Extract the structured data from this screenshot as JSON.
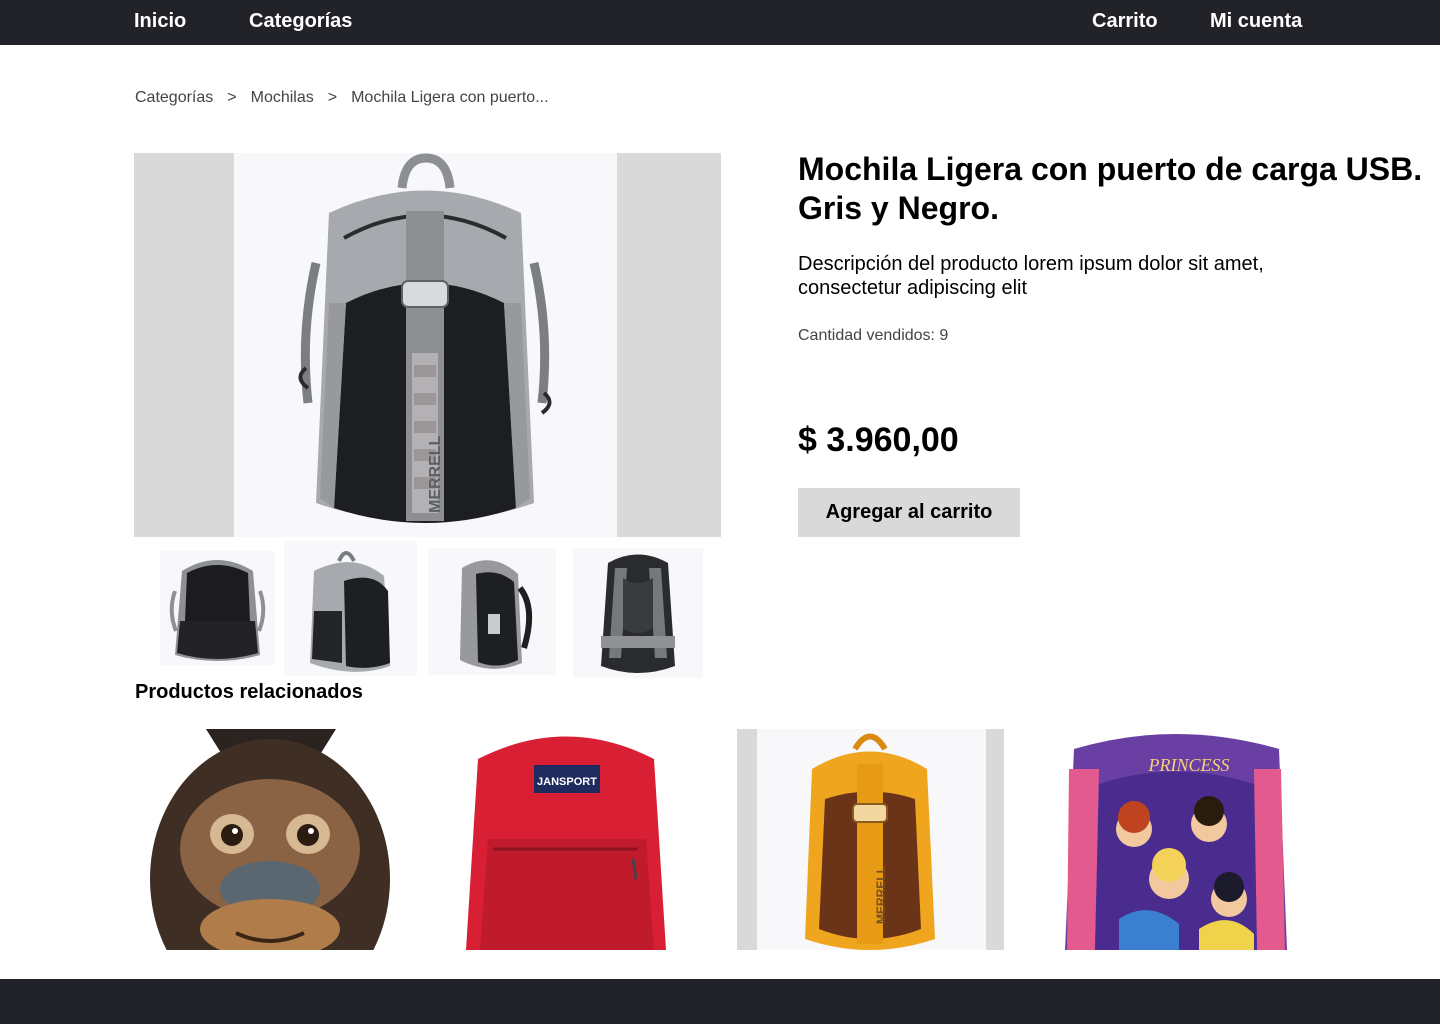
{
  "nav": {
    "home": "Inicio",
    "categories": "Categorías",
    "cart": "Carrito",
    "account": "Mi cuenta"
  },
  "breadcrumb": {
    "items": [
      "Categorías",
      "Mochilas",
      "Mochila Ligera con puerto..."
    ],
    "separator": ">"
  },
  "product": {
    "title": "Mochila Ligera con puerto de carga USB. Gris y Negro.",
    "description": "Descripción del producto lorem ipsum dolor sit amet, consectetur adipiscing elit",
    "sold": "Cantidad vendidos: 9",
    "price": "$ 3.960,00",
    "add_to_cart": "Agregar al carrito",
    "brand": "MERRELL"
  },
  "related": {
    "title": "Productos relacionados",
    "jansport_logo": "JANSPORT",
    "princess_logo": "PRINCESS",
    "orange_brand": "MERRELL"
  },
  "colors": {
    "nav_bg": "#212328",
    "placeholder": "#d9d9d9"
  }
}
